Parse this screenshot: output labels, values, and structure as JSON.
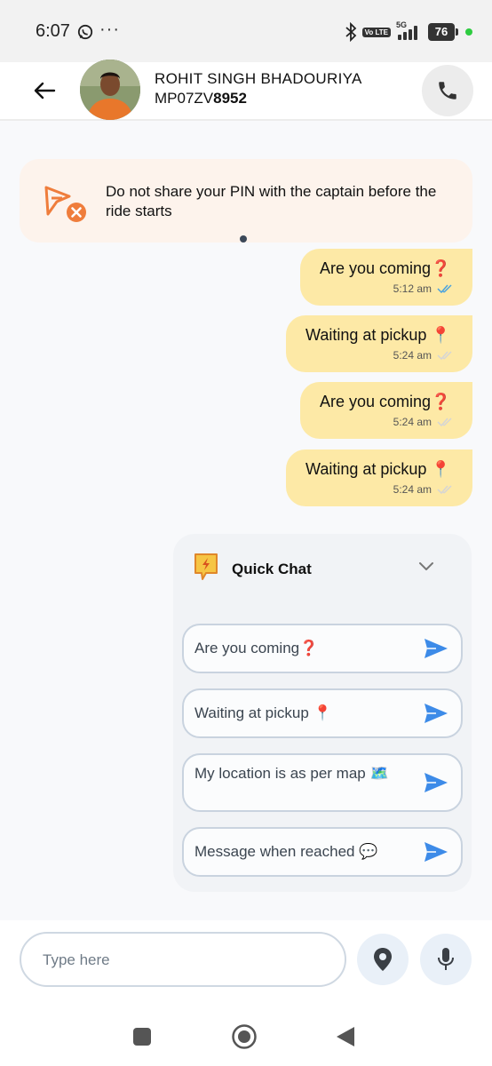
{
  "status_bar": {
    "time": "6:07",
    "dots": "···",
    "volte": "Vo LTE",
    "network": "5G",
    "battery": "76"
  },
  "header": {
    "name": "ROHIT SINGH BHADOURIYA",
    "plate_prefix": "MP07ZV",
    "plate_suffix": "8952"
  },
  "notice": {
    "text": "Do not share your PIN with the captain before the ride starts"
  },
  "messages": [
    {
      "text": "Are you coming❓",
      "time": "5:12 am",
      "read": true
    },
    {
      "text": "Waiting at pickup 📍",
      "time": "5:24 am",
      "read": false
    },
    {
      "text": "Are you coming❓",
      "time": "5:24 am",
      "read": false
    },
    {
      "text": "Waiting at pickup 📍",
      "time": "5:24 am",
      "read": false
    }
  ],
  "quick_chat": {
    "title": "Quick Chat",
    "items": [
      {
        "label": "Are you coming❓"
      },
      {
        "label": "Waiting at pickup 📍"
      },
      {
        "label": "My location is as per map 🗺️"
      },
      {
        "label": "Message when reached 💬"
      }
    ]
  },
  "composer": {
    "placeholder": "Type here"
  },
  "colors": {
    "bubble": "#fde9a6",
    "notice_bg": "#fdf3ec",
    "accent_orange": "#ef7d3c",
    "send_blue": "#3d8be8",
    "read_tick": "#4aa3df"
  }
}
